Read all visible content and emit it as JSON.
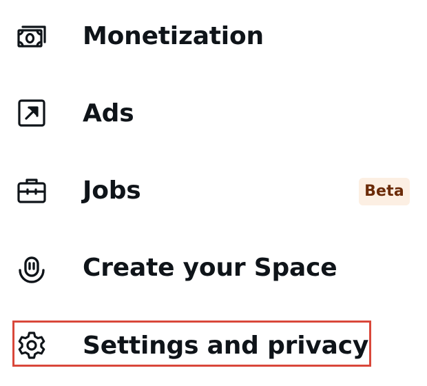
{
  "menu": {
    "items": [
      {
        "label": "Monetization",
        "icon": "monetization-icon"
      },
      {
        "label": "Ads",
        "icon": "arrow-up-right-square-icon"
      },
      {
        "label": "Jobs",
        "icon": "briefcase-icon",
        "badge": "Beta"
      },
      {
        "label": "Create your Space",
        "icon": "microphone-icon"
      },
      {
        "label": "Settings and privacy",
        "icon": "gear-icon"
      }
    ]
  },
  "colors": {
    "text": "#0f1419",
    "background": "#ffffff",
    "badge_bg": "#fcefe3",
    "badge_text": "#6b2b08",
    "highlight_border": "#d9473a"
  }
}
